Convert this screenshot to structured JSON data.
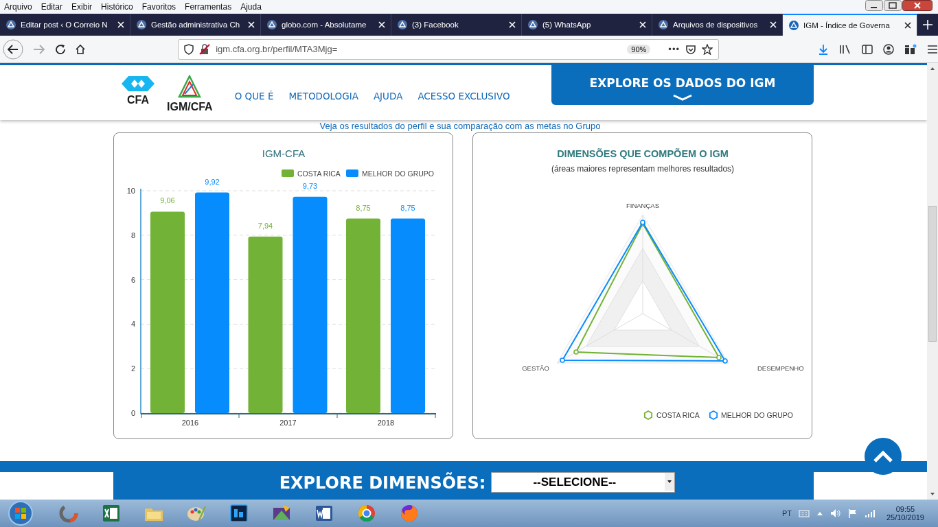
{
  "menu_bar": [
    "Arquivo",
    "Editar",
    "Exibir",
    "Histórico",
    "Favoritos",
    "Ferramentas",
    "Ajuda"
  ],
  "tabs": [
    {
      "title": "Editar post ‹ O Correio N",
      "selected": false
    },
    {
      "title": "Gestão administrativa Ch",
      "selected": false
    },
    {
      "title": "globo.com - Absolutame",
      "selected": false
    },
    {
      "title": "(3) Facebook",
      "selected": false
    },
    {
      "title": "(5) WhatsApp",
      "selected": false
    },
    {
      "title": "Arquivos de dispositivos",
      "selected": false
    },
    {
      "title": "IGM - Índice de Governa",
      "selected": true
    }
  ],
  "address_bar": {
    "url": "igm.cfa.org.br/perfil/MTA3Mjg=",
    "zoom": "90%",
    "more": "•••"
  },
  "site_header": {
    "logos": [
      "CFA",
      "IGM/CFA"
    ],
    "nav": [
      "O QUE É",
      "METODOLOGIA",
      "AJUDA",
      "ACESSO EXCLUSIVO"
    ],
    "explore_button": "EXPLORE OS DADOS DO IGM"
  },
  "intro": "Veja os resultados do perfil e sua comparação com as metas no Grupo",
  "score_chart": {
    "chart_data": {
      "type": "bar",
      "title": "IGM-CFA",
      "categories": [
        "2016",
        "2017",
        "2018"
      ],
      "series": [
        {
          "name": "COSTA RICA",
          "color": "#72b236",
          "values": [
            9.06,
            7.94,
            8.75
          ]
        },
        {
          "name": "MELHOR DO GRUPO",
          "color": "#078cfe",
          "values": [
            9.92,
            9.73,
            8.75
          ]
        }
      ],
      "grid": true,
      "legend": true,
      "ylim": [
        0,
        10
      ],
      "yticks": [
        0,
        2,
        4,
        6,
        8,
        10
      ],
      "value_labels": [
        [
          "9,06",
          "7,94",
          "8,75"
        ],
        [
          "9,92",
          "9,73",
          "8,75"
        ]
      ]
    }
  },
  "dimensions_chart": {
    "title": "DIMENSÕES QUE COMPÕEM O IGM",
    "subtitle": "(áreas maiores representam melhores resultados)",
    "axes": [
      "FINANÇAS",
      "DESEMPENHO",
      "GESTÃO"
    ],
    "series": [
      {
        "name": "COSTA RICA",
        "color": "#72b236"
      },
      {
        "name": "MELHOR DO GRUPO",
        "color": "#078cfe"
      }
    ]
  },
  "explore_dimensions": {
    "label": "EXPLORE DIMENSÕES:",
    "select_value": "--SELECIONE--"
  },
  "taskbar": {
    "language": "PT",
    "time": "09:55",
    "date": "25/10/2019"
  }
}
